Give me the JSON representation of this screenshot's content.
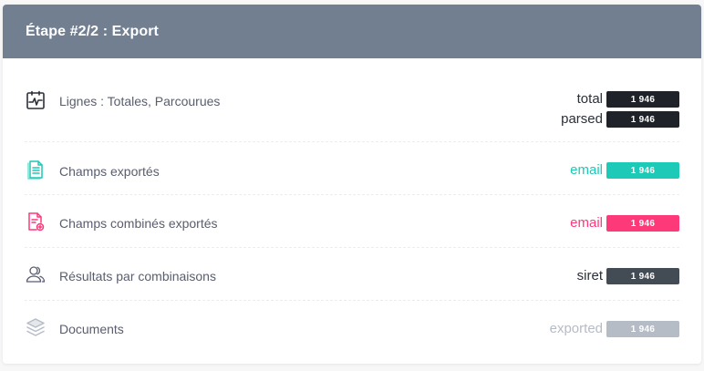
{
  "header": {
    "title": "Étape #2/2 : Export"
  },
  "rows": [
    {
      "label": "Lignes : Totales, Parcourues",
      "icon": "activity-calendar-icon",
      "stats": [
        {
          "key": "total",
          "value": "1 946"
        },
        {
          "key": "parsed",
          "value": "1 946"
        }
      ]
    },
    {
      "label": "Champs exportés",
      "icon": "document-list-icon",
      "stats": [
        {
          "key": "email",
          "value": "1 946"
        }
      ]
    },
    {
      "label": "Champs combinés exportés",
      "icon": "document-add-icon",
      "stats": [
        {
          "key": "email",
          "value": "1 946"
        }
      ]
    },
    {
      "label": "Résultats par combinaisons",
      "icon": "users-icon",
      "stats": [
        {
          "key": "siret",
          "value": "1 946"
        }
      ]
    },
    {
      "label": "Documents",
      "icon": "layers-icon",
      "stats": [
        {
          "key": "exported",
          "value": "1 946"
        }
      ]
    }
  ],
  "colors": {
    "header_bg": "#717f91",
    "dark": "#1f2329",
    "teal": "#1dc9b7",
    "pink": "#fd397a",
    "slate": "#434b55",
    "light": "#b5bcc6"
  }
}
